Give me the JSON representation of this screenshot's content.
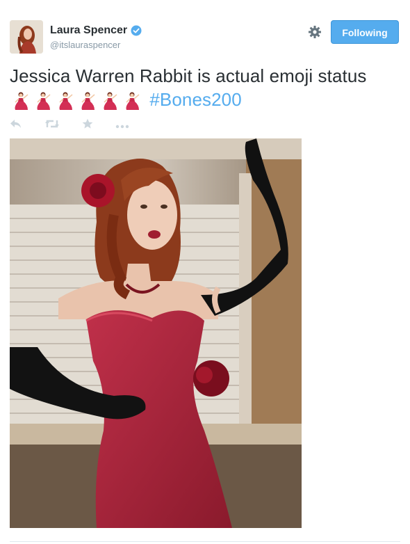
{
  "tweet": {
    "display_name": "Laura Spencer",
    "handle": "@itslauraspencer",
    "follow_button_label": "Following",
    "text_main": "Jessica Warren Rabbit is actual emoji status",
    "emoji_count": 6,
    "emoji_icon": "dancer-emoji",
    "hashtag": "#Bones200",
    "actions": [
      "reply-icon",
      "retweet-icon",
      "favorite-icon",
      "more-icon"
    ],
    "media_description_icon": "photo"
  },
  "colors": {
    "accent": "#55acee",
    "text": "#292f33",
    "muted": "#8899a6",
    "dress": "#b3263a"
  }
}
